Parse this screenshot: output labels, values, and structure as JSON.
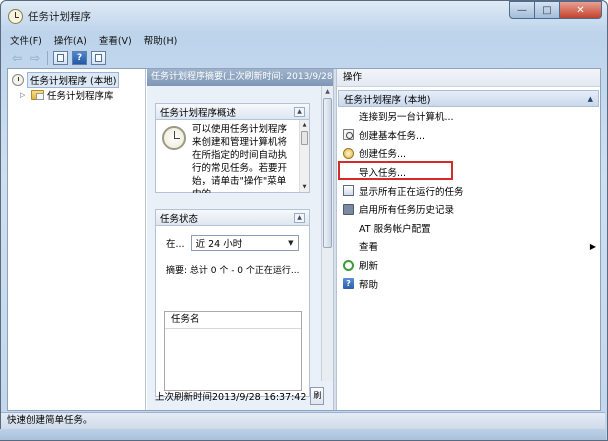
{
  "window": {
    "title": "任务计划程序",
    "controls": {
      "minimize": "—",
      "maximize": "□",
      "close": "✕"
    }
  },
  "menu": [
    "文件(F)",
    "操作(A)",
    "查看(V)",
    "帮助(H)"
  ],
  "toolbar": {
    "help_label": "?"
  },
  "tree": {
    "root": "任务计划程序 (本地)",
    "child": "任务计划程序库"
  },
  "middle": {
    "header": "任务计划程序摘要(上次刷新时间: 2013/9/28",
    "overview": {
      "title": "任务计划程序概述",
      "text": "可以使用任务计划程序来创建和管理计算机将在所指定的时间自动执行的常见任务。若要开始，请单击\"操作\"菜单中的"
    },
    "status": {
      "title": "任务状态",
      "range_label": "在...",
      "range_value": "近 24 小时",
      "summary": "摘要: 总计 0 个 - 0 个正在运行...",
      "table_header": "任务名"
    },
    "footer": {
      "last_refresh": "上次刷新时间2013/9/28 16:37:42",
      "refresh_button": "刷"
    }
  },
  "actions": {
    "header": "操作",
    "group": "任务计划程序 (本地)",
    "items": [
      {
        "label": "连接到另一台计算机...",
        "icon": "blank"
      },
      {
        "label": "创建基本任务...",
        "icon": "create-basic-task-icon",
        "highlighted": true
      },
      {
        "label": "创建任务...",
        "icon": "create-task-icon"
      },
      {
        "label": "导入任务...",
        "icon": "blank"
      },
      {
        "label": "显示所有正在运行的任务",
        "icon": "running-tasks-icon"
      },
      {
        "label": "启用所有任务历史记录",
        "icon": "history-icon"
      },
      {
        "label": "AT 服务帐户配置",
        "icon": "blank"
      },
      {
        "label": "查看",
        "icon": "blank",
        "submenu": true
      },
      {
        "label": "刷新",
        "icon": "refresh-icon"
      },
      {
        "label": "帮助",
        "icon": "help-icon"
      }
    ],
    "help_glyph": "?",
    "submenu_glyph": "▶"
  },
  "statusbar": {
    "text": "快速创建简单任务。"
  },
  "colors": {
    "highlight_box": "#d42a2a",
    "titlebar": "#b9d1ea",
    "close_button": "#c3432c"
  }
}
